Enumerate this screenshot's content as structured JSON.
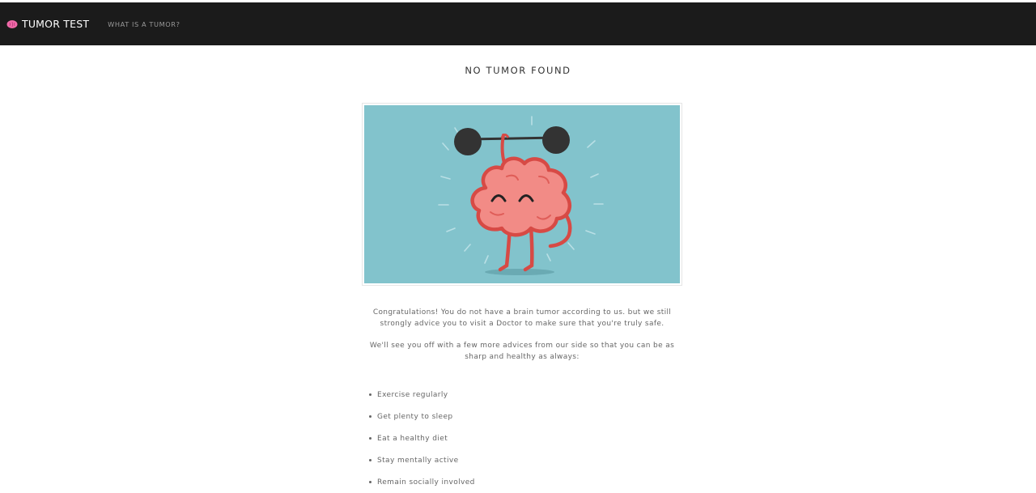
{
  "navbar": {
    "brand_icon": "brain-icon",
    "brand_title": "TUMOR TEST",
    "link_what": "WHAT IS A TUMOR?"
  },
  "result": {
    "heading": "NO TUMOR FOUND",
    "illustration": "brain-lifting-barbell",
    "paragraph_1": "Congratulations! You do not have a brain tumor according to us. but we still strongly advice you to visit a Doctor to make sure that you're truly safe.",
    "paragraph_2": "We'll see you off with a few more advices from our side so that you can be as sharp and healthy as always:",
    "advices": [
      "Exercise regularly",
      "Get plenty to sleep",
      "Eat a healthy diet",
      "Stay mentally active",
      "Remain socially involved"
    ]
  },
  "colors": {
    "navbar_bg": "#1b1b1b",
    "brand_icon": "#f06aa8",
    "illustration_bg": "#82c3cc",
    "brain_fill": "#f28b86",
    "brain_stroke": "#d74a45"
  }
}
